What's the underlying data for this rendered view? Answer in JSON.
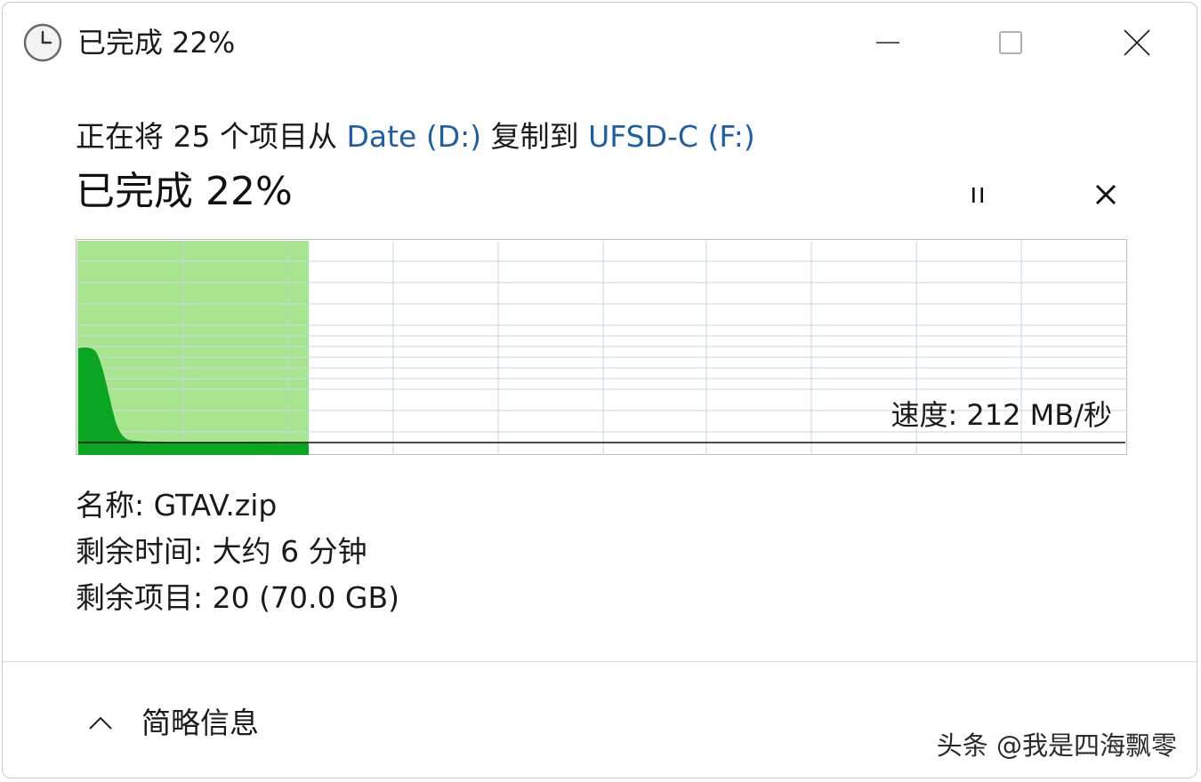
{
  "window": {
    "title": "已完成 22%"
  },
  "header": {
    "copy_prefix": "正在将 25 个项目从 ",
    "source": "Date (D:)",
    "copy_middle": " 复制到 ",
    "destination": "UFSD-C (F:)"
  },
  "progress": {
    "title": "已完成 22%",
    "percent_complete": 22,
    "speed_label": "速度: 212 MB/秒"
  },
  "details": {
    "name": "名称: GTAV.zip",
    "time_remaining": "剩余时间: 大约 6 分钟",
    "items_remaining": "剩余项目: 20 (70.0 GB)"
  },
  "footer": {
    "less_details_label": "简略信息",
    "watermark": "头条 @我是四海飘零"
  },
  "colors": {
    "progress_fill": "#a8e58f",
    "speed_fill": "#0aa521",
    "link": "#1d5fa6",
    "grid": "#c4d6e6"
  },
  "icons": {
    "app": "clock-icon",
    "minimize": "minimize-icon",
    "maximize": "maximize-icon",
    "close": "close-icon",
    "pause": "pause-icon",
    "cancel": "cancel-icon",
    "less_details": "chevron-up-icon"
  }
}
